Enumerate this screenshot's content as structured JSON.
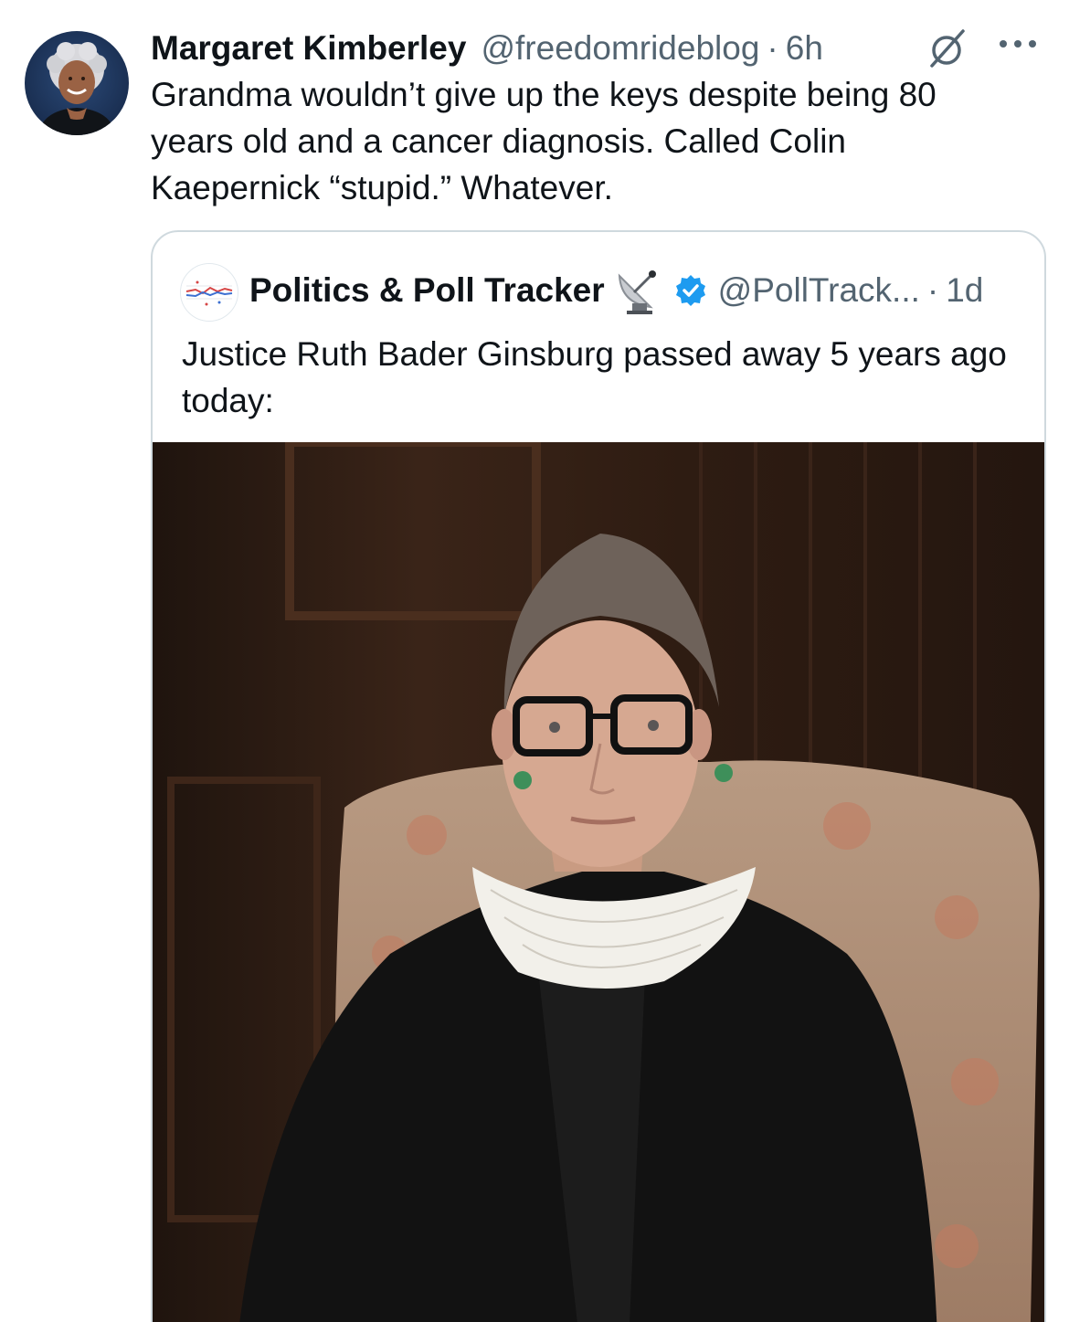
{
  "tweet": {
    "author": {
      "display_name": "Margaret Kimberley",
      "handle": "@freedomrideblog",
      "separator": "·",
      "time": "6h",
      "avatar_icon": "profile-photo"
    },
    "grok_icon": "grok-icon",
    "more_icon": "more-options-icon",
    "text": "Grandma wouldn’t give up the keys despite being 80\nyears old and a cancer diagnosis. Called Colin\nKaepernick “stupid.” Whatever."
  },
  "quote": {
    "author": {
      "display_name": "Politics & Poll Tracker",
      "emoji_icon": "satellite-dish-icon",
      "verified_icon": "verified-badge-icon",
      "verified_color": "#1d9bf0",
      "handle": "@PollTrack...",
      "separator": "·",
      "time": "1d"
    },
    "text": "Justice Ruth Bader Ginsburg passed away 5 years ago today:",
    "media": {
      "type": "photo"
    }
  },
  "colors": {
    "text_primary": "#0f1419",
    "text_secondary": "#536471",
    "border": "#cfd9de"
  }
}
